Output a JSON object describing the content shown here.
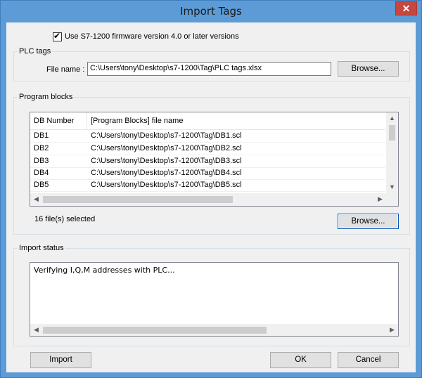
{
  "window": {
    "title": "Import Tags",
    "close_glyph": "✕"
  },
  "firmware_checkbox": {
    "label": "Use S7-1200 firmware version 4.0 or later versions",
    "checked": true
  },
  "plc_tags": {
    "group_label": "PLC tags",
    "file_label": "File name :",
    "file_value": "C:\\Users\\tony\\Desktop\\s7-1200\\Tag\\PLC tags.xlsx",
    "browse_label": "Browse..."
  },
  "program_blocks": {
    "group_label": "Program blocks",
    "columns": [
      "DB Number",
      "[Program Blocks] file name"
    ],
    "rows": [
      {
        "db": "DB1",
        "file": "C:\\Users\\tony\\Desktop\\s7-1200\\Tag\\DB1.scl"
      },
      {
        "db": "DB2",
        "file": "C:\\Users\\tony\\Desktop\\s7-1200\\Tag\\DB2.scl"
      },
      {
        "db": "DB3",
        "file": "C:\\Users\\tony\\Desktop\\s7-1200\\Tag\\DB3.scl"
      },
      {
        "db": "DB4",
        "file": "C:\\Users\\tony\\Desktop\\s7-1200\\Tag\\DB4.scl"
      },
      {
        "db": "DB5",
        "file": "C:\\Users\\tony\\Desktop\\s7-1200\\Tag\\DB5.scl"
      }
    ],
    "selected_text": "16 file(s) selected",
    "browse_label": "Browse..."
  },
  "import_status": {
    "group_label": "Import status",
    "text": "Verifying I,Q,M addresses with PLC..."
  },
  "buttons": {
    "import": "Import",
    "ok": "OK",
    "cancel": "Cancel"
  }
}
